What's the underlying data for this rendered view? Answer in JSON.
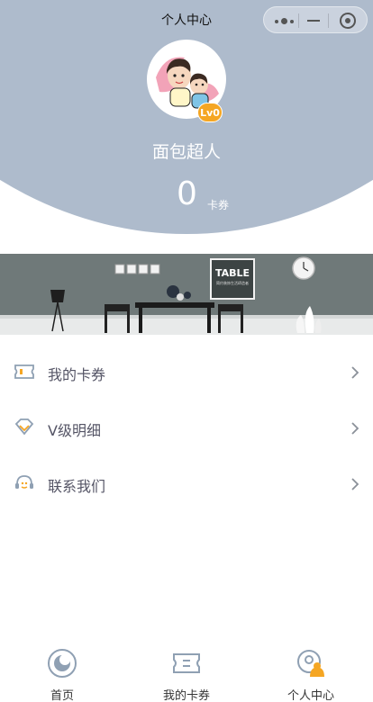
{
  "header": {
    "title": "个人中心",
    "nickname": "面包超人",
    "level": "Lv0",
    "coupon_count": "0",
    "coupon_label": "卡券",
    "bg_color": "#aebbcc",
    "badge_color": "#f5a623"
  },
  "capsule": {
    "more_icon": "more-dots-icon",
    "close_icon": "minimize-icon",
    "home_icon": "target-icon"
  },
  "banner": {
    "sign_text": "TABLE",
    "sign_subtext": "简约装饰生活缔造者"
  },
  "menu": {
    "items": [
      {
        "label": "我的卡券",
        "icon": "ticket-icon"
      },
      {
        "label": "V级明细",
        "icon": "diamond-icon"
      },
      {
        "label": "联系我们",
        "icon": "headset-icon"
      }
    ]
  },
  "tabbar": {
    "items": [
      {
        "label": "首页",
        "icon": "home-icon"
      },
      {
        "label": "我的卡券",
        "icon": "coupon-icon"
      },
      {
        "label": "个人中心",
        "icon": "profile-icon",
        "active": true
      }
    ]
  }
}
